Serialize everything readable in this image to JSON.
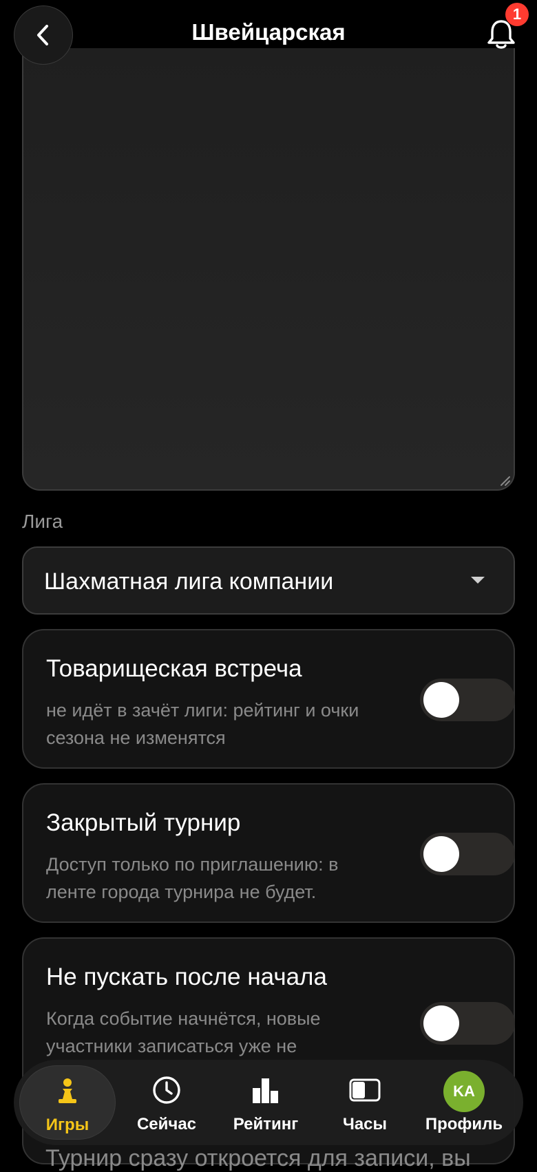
{
  "header": {
    "title": "Швейцарская",
    "notification_count": "1",
    "back_icon": "chevron-left-icon",
    "bell_icon": "bell-icon"
  },
  "league": {
    "label": "Лига",
    "selected": "Шахматная лига компании"
  },
  "options": [
    {
      "title": "Товарищеская встреча",
      "description": "не идёт в зачёт лиги: рейтинг и очки сезона не изменятся",
      "enabled": false
    },
    {
      "title": "Закрытый турнир",
      "description": "Доступ только по приглашению: в ленте города турнира не будет.",
      "enabled": false
    },
    {
      "title": "Не пускать после начала",
      "description": "Когда событие начнётся, новые участники записаться уже не",
      "enabled": false
    }
  ],
  "hidden_next_text": "Турнир сразу откроется для записи, вы",
  "tabs": [
    {
      "label": "Игры",
      "icon": "pawn-icon",
      "active": true
    },
    {
      "label": "Сейчас",
      "icon": "clock-icon",
      "active": false
    },
    {
      "label": "Рейтинг",
      "icon": "bar-chart-icon",
      "active": false
    },
    {
      "label": "Часы",
      "icon": "chess-clock-icon",
      "active": false
    },
    {
      "label": "Профиль",
      "icon": "avatar",
      "active": false,
      "initials": "KA"
    }
  ],
  "colors": {
    "accent": "#f5c518",
    "badge": "#ff3b30",
    "avatar": "#7ab02e"
  }
}
